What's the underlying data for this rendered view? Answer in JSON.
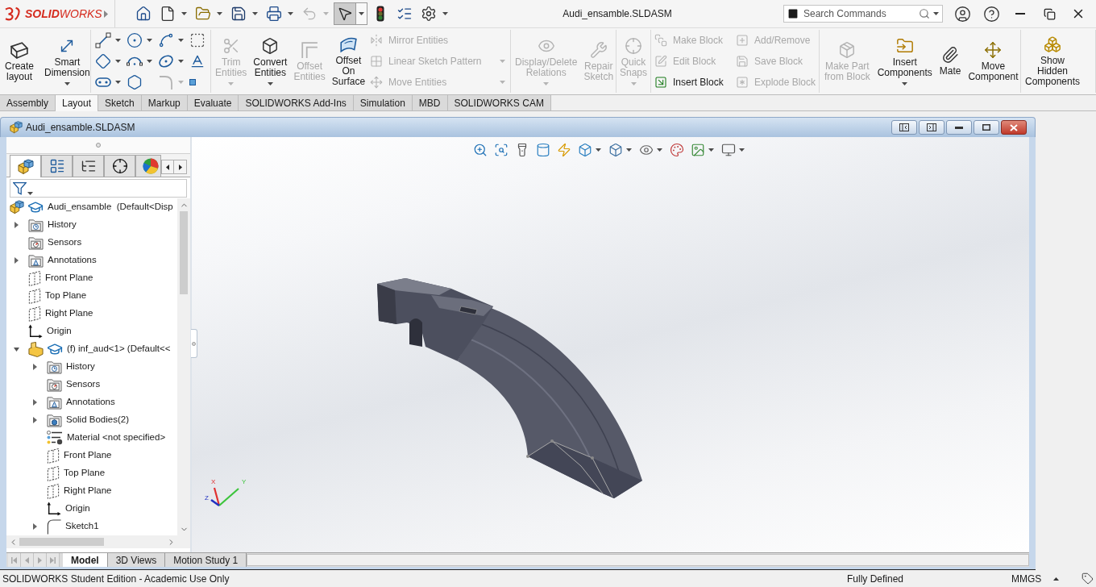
{
  "app": {
    "logo": "**SOLID**WORKS",
    "title": "Audi_ensamble.SLDASM"
  },
  "quick_access": [
    {
      "dropdown": false,
      "disabled": false,
      "selected": false
    },
    {
      "dropdown": true,
      "disabled": false,
      "selected": false
    },
    {
      "dropdown": true,
      "disabled": false,
      "selected": false
    },
    {
      "dropdown": true,
      "disabled": false,
      "selected": false
    },
    {
      "dropdown": true,
      "disabled": false,
      "selected": false
    },
    {
      "dropdown": true,
      "disabled": true,
      "selected": false
    },
    {
      "dropdown": true,
      "disabled": false,
      "selected": true
    },
    {
      "dropdown": false,
      "disabled": false,
      "selected": false
    },
    {
      "dropdown": false,
      "disabled": false,
      "selected": false
    },
    {
      "dropdown": true,
      "disabled": false,
      "selected": false
    }
  ],
  "search": {
    "placeholder": "Search Commands"
  },
  "ribbon": [
    {
      "columns": [
        [
          {
            "kind": "large",
            "label": "Create\nlayout",
            "disabled": false,
            "dropdown": false
          }
        ],
        [
          {
            "kind": "large",
            "label": "Smart\nDimension",
            "disabled": false,
            "dropdown": true
          }
        ]
      ]
    },
    {
      "columns": [
        [
          {
            "kind": "tool",
            "disabled": false,
            "dropdown": true
          },
          {
            "kind": "tool",
            "disabled": false,
            "dropdown": true
          },
          {
            "kind": "tool",
            "disabled": false,
            "dropdown": true
          }
        ],
        [
          {
            "kind": "tool",
            "disabled": false,
            "dropdown": true
          },
          {
            "kind": "tool",
            "disabled": false,
            "dropdown": true
          },
          {
            "kind": "tool",
            "disabled": false,
            "dropdown": false
          }
        ],
        [
          {
            "kind": "tool",
            "disabled": false,
            "dropdown": true
          },
          {
            "kind": "tool",
            "disabled": false,
            "dropdown": true
          },
          {
            "kind": "tool",
            "disabled": true,
            "dropdown": true
          }
        ],
        [
          {
            "kind": "tool",
            "disabled": false,
            "dropdown": false
          },
          {
            "kind": "tool",
            "disabled": false,
            "dropdown": false
          },
          {
            "kind": "tool",
            "disabled": false,
            "dropdown": false
          }
        ]
      ]
    },
    {
      "columns": [
        [
          {
            "kind": "large",
            "label": "Trim\nEntities",
            "disabled": true,
            "dropdown": true
          }
        ],
        [
          {
            "kind": "large",
            "label": "Convert\nEntities",
            "disabled": false,
            "dropdown": true
          }
        ],
        [
          {
            "kind": "large",
            "label": "Offset\nEntities",
            "disabled": true,
            "dropdown": false
          }
        ],
        [
          {
            "kind": "large",
            "label": "Offset\nOn\nSurface",
            "disabled": false,
            "dropdown": false
          }
        ],
        [
          {
            "kind": "small",
            "label": "Mirror Entities",
            "disabled": true,
            "dropdown": false
          },
          {
            "kind": "small",
            "label": "Linear Sketch Pattern",
            "disabled": true,
            "dropdown": true
          },
          {
            "kind": "small",
            "label": "Move Entities",
            "disabled": true,
            "dropdown": true
          }
        ]
      ]
    },
    {
      "columns": [
        [
          {
            "kind": "large",
            "label": "Display/Delete\nRelations",
            "disabled": true,
            "dropdown": true
          }
        ],
        [
          {
            "kind": "large",
            "label": "Repair\nSketch",
            "disabled": true,
            "dropdown": false
          }
        ]
      ]
    },
    {
      "columns": [
        [
          {
            "kind": "large",
            "label": "Quick\nSnaps",
            "disabled": true,
            "dropdown": true
          }
        ]
      ]
    },
    {
      "columns": [
        [
          {
            "kind": "small",
            "label": "Make Block",
            "disabled": true,
            "dropdown": false
          },
          {
            "kind": "small",
            "label": "Edit Block",
            "disabled": true,
            "dropdown": false
          },
          {
            "kind": "small",
            "label": "Insert Block",
            "disabled": false,
            "dropdown": false
          }
        ],
        [
          {
            "kind": "small",
            "label": "Add/Remove",
            "disabled": true,
            "dropdown": false
          },
          {
            "kind": "small",
            "label": "Save Block",
            "disabled": true,
            "dropdown": false
          },
          {
            "kind": "small",
            "label": "Explode Block",
            "disabled": true,
            "dropdown": false
          }
        ]
      ]
    },
    {
      "columns": [
        [
          {
            "kind": "large",
            "label": "Make Part\nfrom Block",
            "disabled": true,
            "dropdown": false
          }
        ],
        [
          {
            "kind": "large",
            "label": "Insert\nComponents",
            "disabled": false,
            "dropdown": true
          }
        ],
        [
          {
            "kind": "large",
            "label": "Mate",
            "disabled": false,
            "dropdown": false
          }
        ],
        [
          {
            "kind": "large",
            "label": "Move\nComponent",
            "disabled": false,
            "dropdown": false
          }
        ]
      ]
    },
    {
      "columns": [
        [
          {
            "kind": "large",
            "label": "Show\nHidden\nComponents",
            "disabled": false,
            "dropdown": false
          }
        ]
      ]
    }
  ],
  "tabs": [
    {
      "label": "Assembly",
      "selected": false
    },
    {
      "label": "Layout",
      "selected": true
    },
    {
      "label": "Sketch",
      "selected": false
    },
    {
      "label": "Markup",
      "selected": false
    },
    {
      "label": "Evaluate",
      "selected": false
    },
    {
      "label": "SOLIDWORKS Add-Ins",
      "selected": false
    },
    {
      "label": "Simulation",
      "selected": false
    },
    {
      "label": "MBD",
      "selected": false
    },
    {
      "label": "SOLIDWORKS CAM",
      "selected": false
    }
  ],
  "document": {
    "title": "Audi_ensamble.SLDASM",
    "panel_tabs": [
      {
        "selected": true
      },
      {
        "selected": false
      },
      {
        "selected": false
      },
      {
        "selected": false
      },
      {
        "selected": false
      }
    ],
    "tree": [
      {
        "label": "Audi_ensamble  (Default<Disp",
        "kind": "assembly",
        "children": [
          {
            "label": "History",
            "kind": "history",
            "expanded": false
          },
          {
            "label": "Sensors",
            "kind": "sensors"
          },
          {
            "label": "Annotations",
            "kind": "annotations",
            "expanded": false
          },
          {
            "label": "Front Plane",
            "kind": "plane"
          },
          {
            "label": "Top Plane",
            "kind": "plane"
          },
          {
            "label": "Right Plane",
            "kind": "plane"
          },
          {
            "label": "Origin",
            "kind": "origin"
          },
          {
            "label": "(f) inf_aud<1> (Default<<",
            "kind": "part",
            "expanded": true,
            "children": [
              {
                "label": "History",
                "kind": "history",
                "expanded": false
              },
              {
                "label": "Sensors",
                "kind": "sensors"
              },
              {
                "label": "Annotations",
                "kind": "annotations",
                "expanded": false
              },
              {
                "label": "Solid Bodies(2)",
                "kind": "bodies",
                "expanded": false
              },
              {
                "label": "Material <not specified>",
                "kind": "material"
              },
              {
                "label": "Front Plane",
                "kind": "plane"
              },
              {
                "label": "Top Plane",
                "kind": "plane"
              },
              {
                "label": "Right Plane",
                "kind": "plane"
              },
              {
                "label": "Origin",
                "kind": "origin"
              },
              {
                "label": "Sketch1",
                "kind": "sketch",
                "expanded": false
              }
            ]
          }
        ]
      }
    ],
    "view_toolbar": [
      {
        "dropdown": false
      },
      {
        "dropdown": false
      },
      {
        "dropdown": false
      },
      {
        "dropdown": false
      },
      {
        "dropdown": false
      },
      {
        "dropdown": true
      },
      {
        "dropdown": true
      },
      {
        "dropdown": true
      },
      {
        "dropdown": false
      },
      {
        "dropdown": true
      },
      {
        "dropdown": true
      }
    ],
    "triad": {
      "x": "X",
      "y": "Y",
      "z": "Z"
    },
    "bottom_tabs": [
      {
        "label": "Model",
        "selected": true
      },
      {
        "label": "3D Views",
        "selected": false
      },
      {
        "label": "Motion Study 1",
        "selected": false
      }
    ]
  },
  "status_bar": {
    "edition": "SOLIDWORKS Student Edition - Academic Use Only",
    "sketch_status": "Fully Defined",
    "units": "MMGS"
  }
}
